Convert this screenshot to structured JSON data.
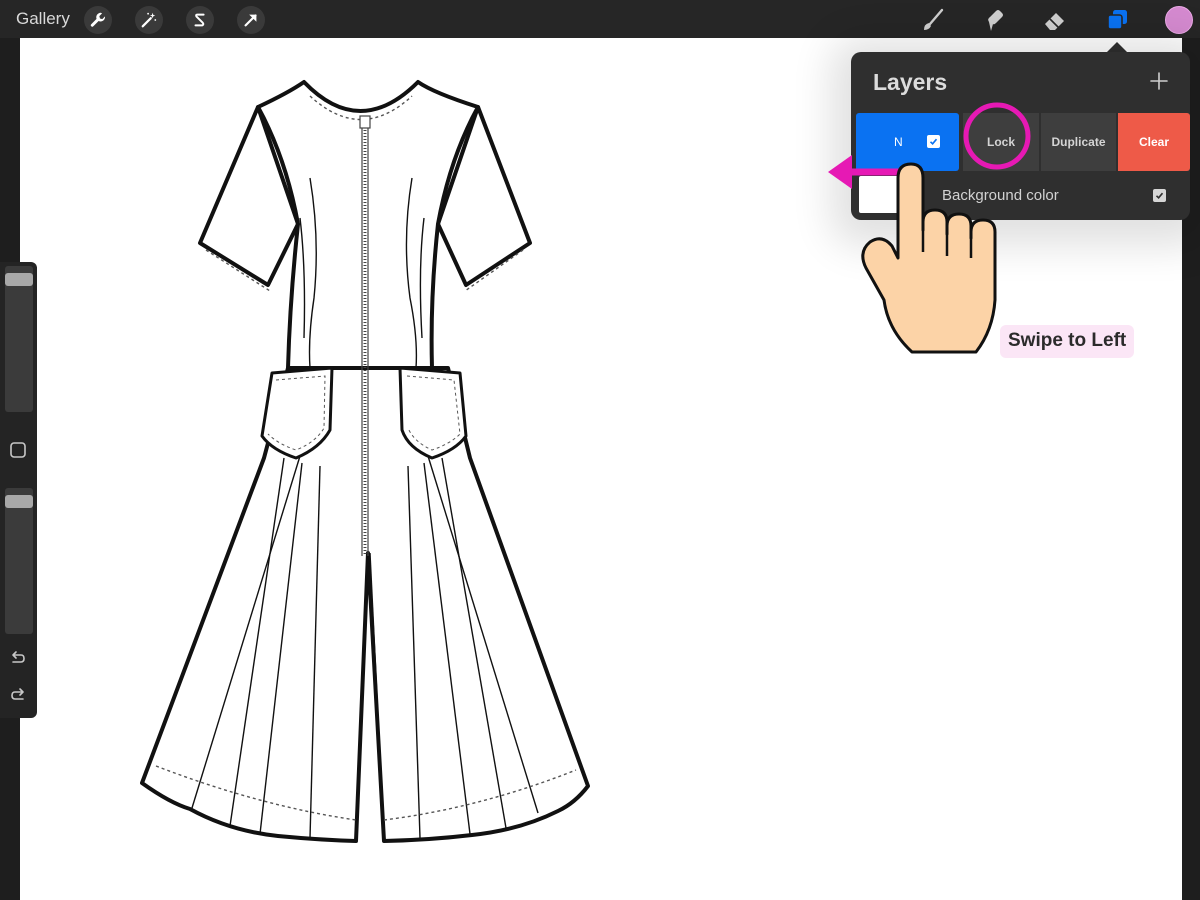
{
  "toolbar": {
    "gallery_label": "Gallery",
    "left_tools": [
      "wrench-icon",
      "magic-wand-icon",
      "selection-s-icon",
      "transform-arrow-icon"
    ],
    "right_tools": [
      "brush-icon",
      "smudge-icon",
      "eraser-icon",
      "layers-icon"
    ],
    "active_tool": "layers-icon",
    "current_color": "#d58ad0"
  },
  "sidebar": {
    "brush_size_level": 0.05,
    "opacity_level": 0.05,
    "modify_button": "square-modify-icon",
    "undo": "undo-icon",
    "redo": "redo-icon"
  },
  "layers_panel": {
    "title": "Layers",
    "add_icon": "plus-icon",
    "layer": {
      "blend_mode": "N",
      "visible": true,
      "swipe_actions": {
        "lock": "Lock",
        "duplicate": "Duplicate",
        "clear": "Clear"
      }
    },
    "background": {
      "label": "Background color",
      "visible": true,
      "color": "#ffffff"
    },
    "accent_color": "#0a72f2",
    "clear_color": "#ee5a48"
  },
  "annotation": {
    "label": "Swipe to Left",
    "highlight_color": "#e619b4"
  }
}
